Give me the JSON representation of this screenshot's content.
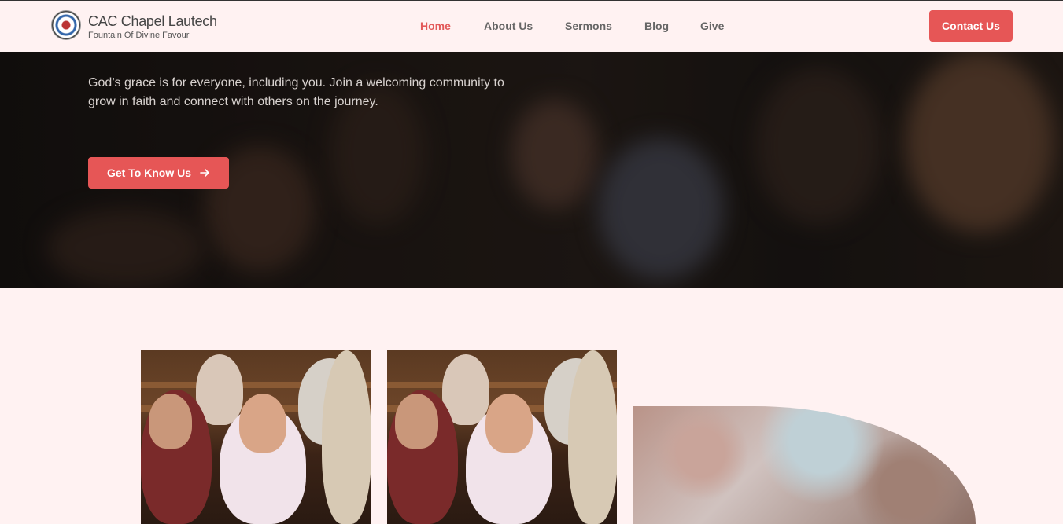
{
  "brand": {
    "title": "CAC Chapel Lautech",
    "subtitle": "Fountain Of Divine Favour"
  },
  "nav": {
    "items": [
      {
        "label": "Home",
        "active": true
      },
      {
        "label": "About Us",
        "active": false
      },
      {
        "label": "Sermons",
        "active": false
      },
      {
        "label": "Blog",
        "active": false
      },
      {
        "label": "Give",
        "active": false
      }
    ],
    "contact_label": "Contact Us"
  },
  "hero": {
    "text": "God’s grace is for everyone, including you. Join a welcoming community to grow in faith and connect with others on the journey.",
    "cta_label": "Get To Know Us",
    "cta_icon": "arrow-right-icon"
  },
  "colors": {
    "accent": "#e65656",
    "page_bg": "#fff2f2",
    "nav_text": "#666666"
  }
}
